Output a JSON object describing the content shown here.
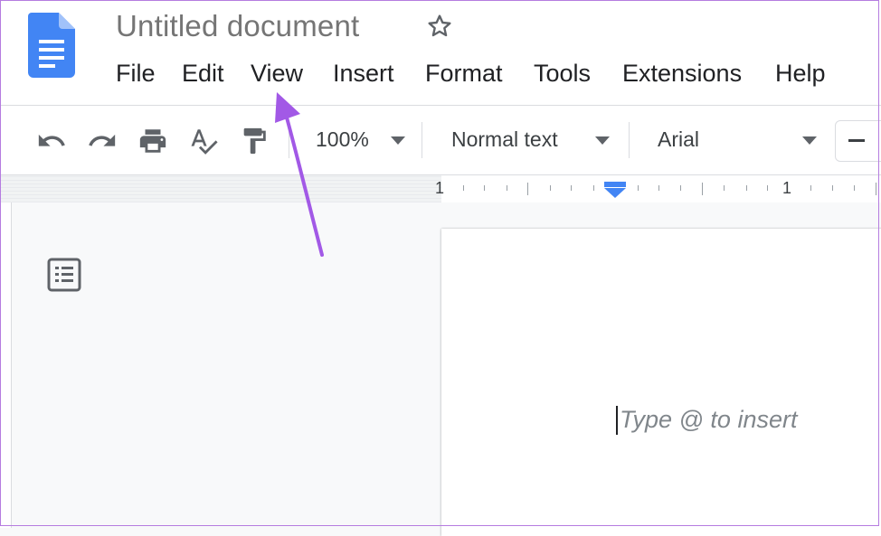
{
  "document": {
    "title": "Untitled document",
    "placeholder": "Type @ to insert"
  },
  "menu": {
    "items": [
      "File",
      "Edit",
      "View",
      "Insert",
      "Format",
      "Tools",
      "Extensions",
      "Help"
    ]
  },
  "toolbar": {
    "zoom": "100%",
    "style": "Normal text",
    "font": "Arial"
  },
  "ruler": {
    "left_number": "1",
    "right_number": "1"
  },
  "icons": {
    "logo": "google-docs-icon",
    "star": "star-icon",
    "undo": "undo-icon",
    "redo": "redo-icon",
    "print": "print-icon",
    "spellcheck": "spellcheck-icon",
    "paint_format": "paint-format-icon",
    "outline": "document-outline-icon",
    "decrease_font": "minus-icon"
  },
  "colors": {
    "brand_blue": "#4285f4",
    "annotation_purple": "#a259e6",
    "text_primary": "#202124",
    "text_muted": "#757575"
  }
}
